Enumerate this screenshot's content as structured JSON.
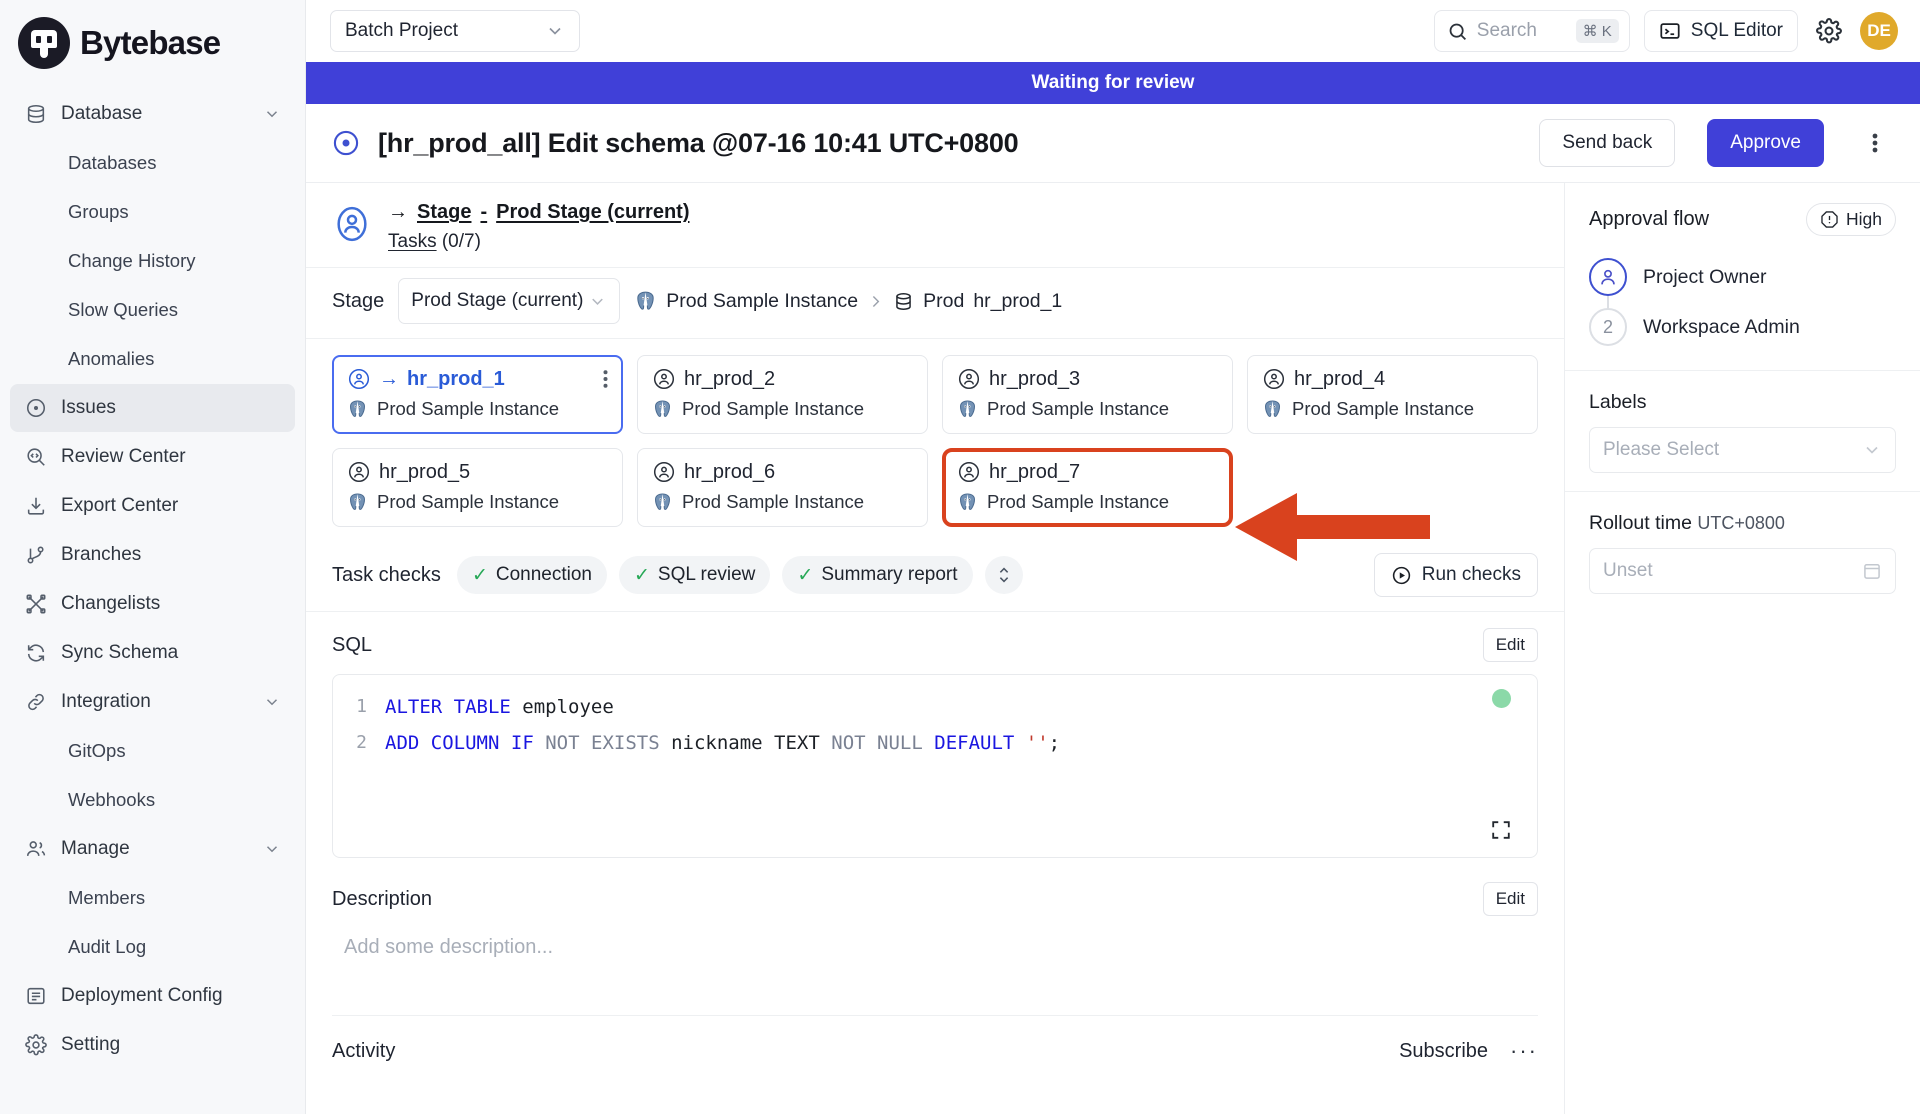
{
  "sidebar": {
    "brand": "Bytebase",
    "items": [
      {
        "label": "Database",
        "icon": "database-icon",
        "type": "group",
        "expandable": true
      },
      {
        "label": "Databases",
        "icon": "",
        "type": "child"
      },
      {
        "label": "Groups",
        "icon": "",
        "type": "child"
      },
      {
        "label": "Change History",
        "icon": "",
        "type": "child"
      },
      {
        "label": "Slow Queries",
        "icon": "",
        "type": "child"
      },
      {
        "label": "Anomalies",
        "icon": "",
        "type": "child"
      },
      {
        "label": "Issues",
        "icon": "issues-icon",
        "type": "item",
        "active": true
      },
      {
        "label": "Review Center",
        "icon": "review-center-icon",
        "type": "item"
      },
      {
        "label": "Export Center",
        "icon": "export-center-icon",
        "type": "item"
      },
      {
        "label": "Branches",
        "icon": "branches-icon",
        "type": "item"
      },
      {
        "label": "Changelists",
        "icon": "changelists-icon",
        "type": "item"
      },
      {
        "label": "Sync Schema",
        "icon": "sync-schema-icon",
        "type": "item"
      },
      {
        "label": "Integration",
        "icon": "integration-icon",
        "type": "group",
        "expandable": true
      },
      {
        "label": "GitOps",
        "icon": "",
        "type": "child"
      },
      {
        "label": "Webhooks",
        "icon": "",
        "type": "child"
      },
      {
        "label": "Manage",
        "icon": "manage-icon",
        "type": "group",
        "expandable": true
      },
      {
        "label": "Members",
        "icon": "",
        "type": "child"
      },
      {
        "label": "Audit Log",
        "icon": "",
        "type": "child"
      },
      {
        "label": "Deployment Config",
        "icon": "deployment-config-icon",
        "type": "item"
      },
      {
        "label": "Setting",
        "icon": "setting-icon",
        "type": "item"
      }
    ]
  },
  "topbar": {
    "project": "Batch Project",
    "search_placeholder": "Search",
    "search_shortcut": "⌘ K",
    "sql_editor": "SQL Editor",
    "avatar_initials": "DE"
  },
  "issue": {
    "status_banner": "Waiting for review",
    "title": "[hr_prod_all] Edit schema @07-16 10:41 UTC+0800",
    "send_back": "Send back",
    "approve": "Approve"
  },
  "stage": {
    "arrow": "→",
    "stage_word": "Stage",
    "dash": "-",
    "stage_name": "Prod Stage (current)",
    "tasks_label": "Tasks",
    "tasks_count": "(0/7)",
    "bar_label": "Stage",
    "dropdown_value": "Prod Stage (current)",
    "breadcrumb_instance": "Prod Sample Instance",
    "breadcrumb_env": "Prod",
    "breadcrumb_db": "hr_prod_1"
  },
  "tasks": [
    {
      "name": "hr_prod_1",
      "instance": "Prod Sample Instance",
      "selected": true,
      "current": true,
      "annotated": false
    },
    {
      "name": "hr_prod_2",
      "instance": "Prod Sample Instance",
      "selected": false,
      "current": false,
      "annotated": false
    },
    {
      "name": "hr_prod_3",
      "instance": "Prod Sample Instance",
      "selected": false,
      "current": false,
      "annotated": false
    },
    {
      "name": "hr_prod_4",
      "instance": "Prod Sample Instance",
      "selected": false,
      "current": false,
      "annotated": false
    },
    {
      "name": "hr_prod_5",
      "instance": "Prod Sample Instance",
      "selected": false,
      "current": false,
      "annotated": false
    },
    {
      "name": "hr_prod_6",
      "instance": "Prod Sample Instance",
      "selected": false,
      "current": false,
      "annotated": false
    },
    {
      "name": "hr_prod_7",
      "instance": "Prod Sample Instance",
      "selected": false,
      "current": false,
      "annotated": true
    }
  ],
  "checks": {
    "label": "Task checks",
    "items": [
      {
        "label": "Connection",
        "status": "pass"
      },
      {
        "label": "SQL review",
        "status": "pass"
      },
      {
        "label": "Summary report",
        "status": "pass"
      }
    ],
    "run_checks": "Run checks"
  },
  "sql": {
    "title": "SQL",
    "edit": "Edit",
    "lines": [
      {
        "no": "1",
        "tokens": [
          {
            "t": "ALTER",
            "c": "kw"
          },
          {
            "t": " ",
            "c": "id"
          },
          {
            "t": "TABLE",
            "c": "kw"
          },
          {
            "t": " employee",
            "c": "id"
          }
        ]
      },
      {
        "no": "2",
        "tokens": [
          {
            "t": "ADD",
            "c": "kw"
          },
          {
            "t": " ",
            "c": "id"
          },
          {
            "t": "COLUMN",
            "c": "kw"
          },
          {
            "t": " ",
            "c": "id"
          },
          {
            "t": "IF",
            "c": "kw"
          },
          {
            "t": " ",
            "c": "id"
          },
          {
            "t": "NOT",
            "c": "kw2"
          },
          {
            "t": " ",
            "c": "id"
          },
          {
            "t": "EXISTS",
            "c": "kw2"
          },
          {
            "t": " nickname ",
            "c": "id"
          },
          {
            "t": "TEXT",
            "c": "id"
          },
          {
            "t": " ",
            "c": "id"
          },
          {
            "t": "NOT",
            "c": "kw2"
          },
          {
            "t": " ",
            "c": "id"
          },
          {
            "t": "NULL",
            "c": "kw2"
          },
          {
            "t": " ",
            "c": "id"
          },
          {
            "t": "DEFAULT",
            "c": "kw"
          },
          {
            "t": " ",
            "c": "id"
          },
          {
            "t": "''",
            "c": "str"
          },
          {
            "t": ";",
            "c": "id"
          }
        ]
      }
    ]
  },
  "description": {
    "title": "Description",
    "edit": "Edit",
    "placeholder": "Add some description..."
  },
  "activity": {
    "title": "Activity",
    "subscribe": "Subscribe",
    "more": "···"
  },
  "right": {
    "approval_title": "Approval flow",
    "priority": "High",
    "flow": [
      {
        "label": "Project Owner",
        "state": "current",
        "marker": ""
      },
      {
        "label": "Workspace Admin",
        "state": "pending",
        "marker": "2"
      }
    ],
    "labels_title": "Labels",
    "labels_placeholder": "Please Select",
    "rollout_title": "Rollout time",
    "rollout_tz": "UTC+0800",
    "rollout_placeholder": "Unset"
  }
}
